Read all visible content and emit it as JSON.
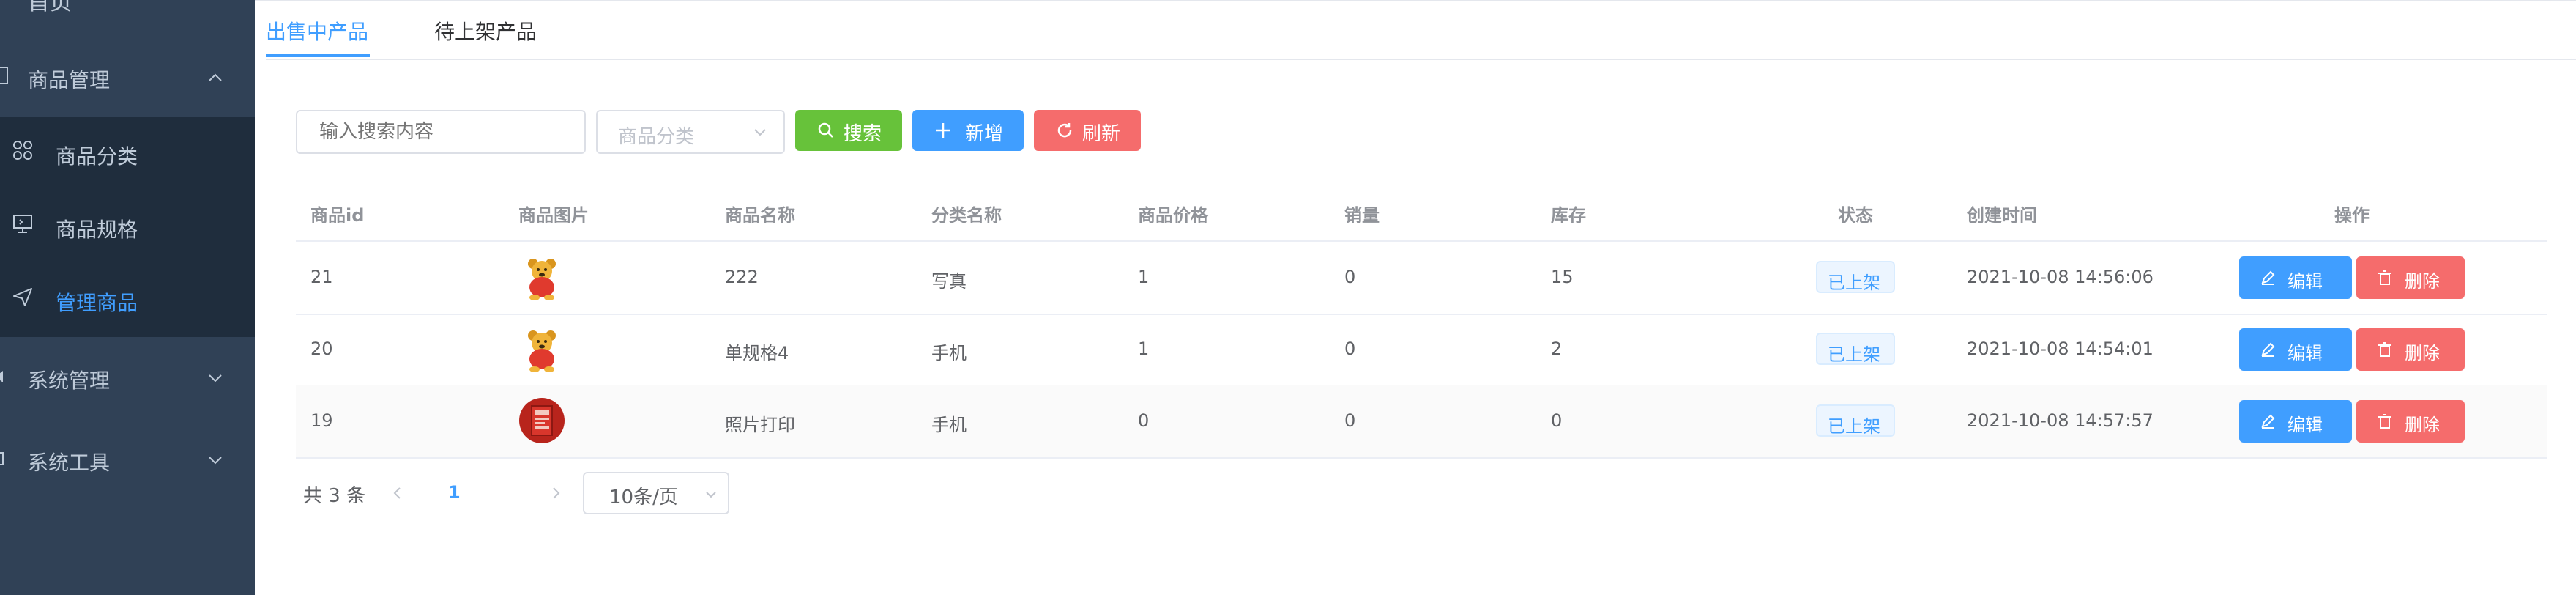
{
  "colors": {
    "sidebar_bg": "#304156",
    "submenu_bg": "#1f2d3d",
    "primary": "#409eff",
    "success": "#67c23a",
    "danger": "#f56c6c"
  },
  "sidebar": {
    "top_partial_label": "首页",
    "groups": [
      {
        "label": "商品管理",
        "icon": "goods-icon",
        "expanded": true,
        "items": [
          {
            "label": "商品分类",
            "icon": "category-icon",
            "active": false
          },
          {
            "label": "商品规格",
            "icon": "monitor-icon",
            "active": false
          },
          {
            "label": "管理商品",
            "icon": "send-icon",
            "active": true
          }
        ]
      },
      {
        "label": "系统管理",
        "icon": "settings-icon",
        "expanded": false
      },
      {
        "label": "系统工具",
        "icon": "tools-icon",
        "expanded": false
      }
    ]
  },
  "tabs": [
    {
      "label": "出售中产品",
      "active": true
    },
    {
      "label": "待上架产品",
      "active": false
    }
  ],
  "toolbar": {
    "search_placeholder": "输入搜索内容",
    "category_placeholder": "商品分类",
    "search_label": "搜索",
    "add_label": "新增",
    "refresh_label": "刷新"
  },
  "table": {
    "headers": [
      "商品id",
      "商品图片",
      "商品名称",
      "分类名称",
      "商品价格",
      "销量",
      "库存",
      "状态",
      "创建时间",
      "操作"
    ],
    "rows": [
      {
        "id": "21",
        "image": "bear-icon",
        "name": "222",
        "category": "写真",
        "price": "1",
        "sales": "0",
        "stock": "15",
        "status": "已上架",
        "created": "2021-10-08 14:56:06"
      },
      {
        "id": "20",
        "image": "bear-icon",
        "name": "单规格4",
        "category": "手机",
        "price": "1",
        "sales": "0",
        "stock": "2",
        "status": "已上架",
        "created": "2021-10-08 14:54:01"
      },
      {
        "id": "19",
        "image": "photo-print-icon",
        "name": "照片打印",
        "category": "手机",
        "price": "0",
        "sales": "0",
        "stock": "0",
        "status": "已上架",
        "created": "2021-10-08 14:57:57"
      }
    ],
    "edit_label": "编辑",
    "delete_label": "删除"
  },
  "pagination": {
    "total_text": "共 3 条",
    "current_page": "1",
    "page_size": "10条/页"
  }
}
